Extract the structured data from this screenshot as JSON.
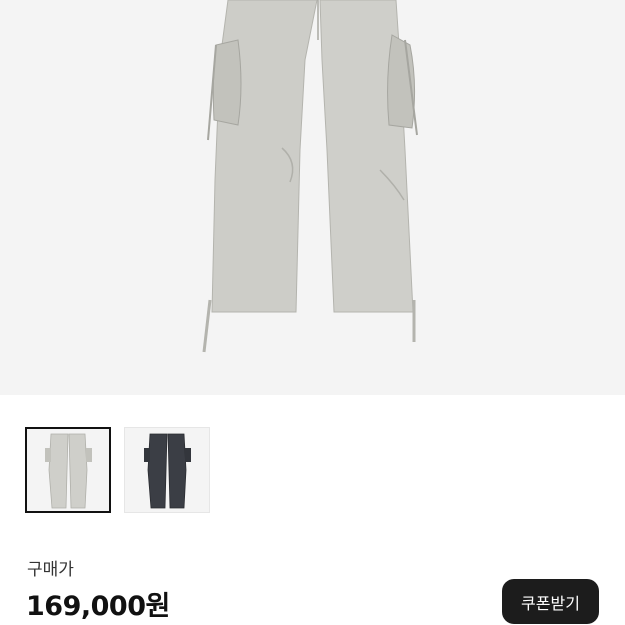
{
  "product": {
    "image": {
      "description_icon": "light-gray-cargo-pants-photo"
    },
    "thumbnails": [
      {
        "icon": "light-gray-cargo-pants-thumbnail",
        "color": "#cfcfca",
        "selected": true
      },
      {
        "icon": "charcoal-cargo-pants-thumbnail",
        "color": "#3b3e45",
        "selected": false
      }
    ],
    "price_label": "구매가",
    "price": "169,000원",
    "coupon_button": "쿠폰받기"
  }
}
